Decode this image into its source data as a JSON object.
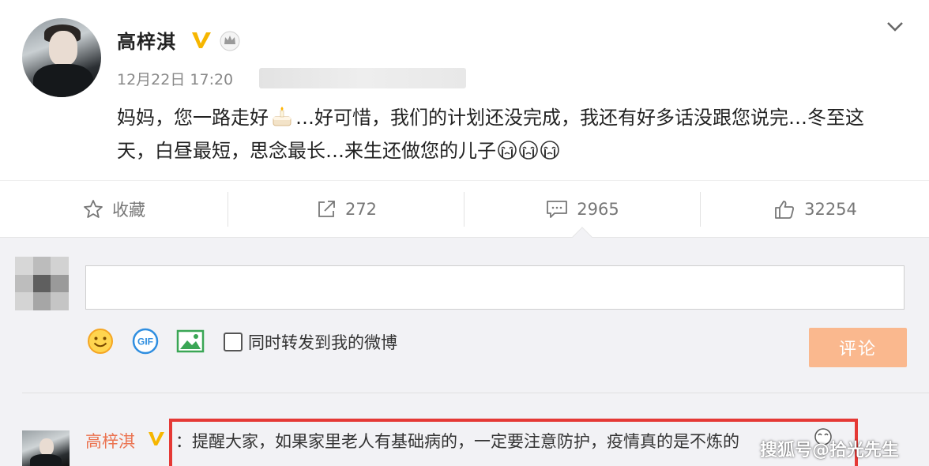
{
  "post": {
    "author": "高梓淇",
    "datetime": "12月22日 17:20",
    "content_part1": "妈妈，您一路走好",
    "content_part2": "…好可惜，我们的计划还没完成，我还有好多话没跟您说完…冬至这天，白昼最短，思念最长…来生还做您的儿子"
  },
  "actions": {
    "favorite_label": "收藏",
    "repost_count": "272",
    "comment_count": "2965",
    "like_count": "32254"
  },
  "composer": {
    "input_value": "",
    "share_label": "同时转发到我的微博",
    "submit_label": "评论"
  },
  "reply": {
    "author": "高梓淇",
    "text": "：提醒大家，如果家里老人有基础病的，一定要注意防护，疫情真的是不炼的"
  },
  "watermark": "搜狐号@拾光先生",
  "colors": {
    "accent_orange": "#eb7350",
    "verified_gold": "#f6b600",
    "submit_disabled": "#fab88e",
    "highlight_red": "#e53935"
  },
  "icons": [
    "verified-icon",
    "crown-icon",
    "chevron-down-icon",
    "candle-cake-emoji",
    "crying-emoji",
    "star-icon",
    "share-icon",
    "comment-icon",
    "thumbs-up-icon",
    "smiley-icon",
    "gif-icon",
    "image-icon"
  ]
}
